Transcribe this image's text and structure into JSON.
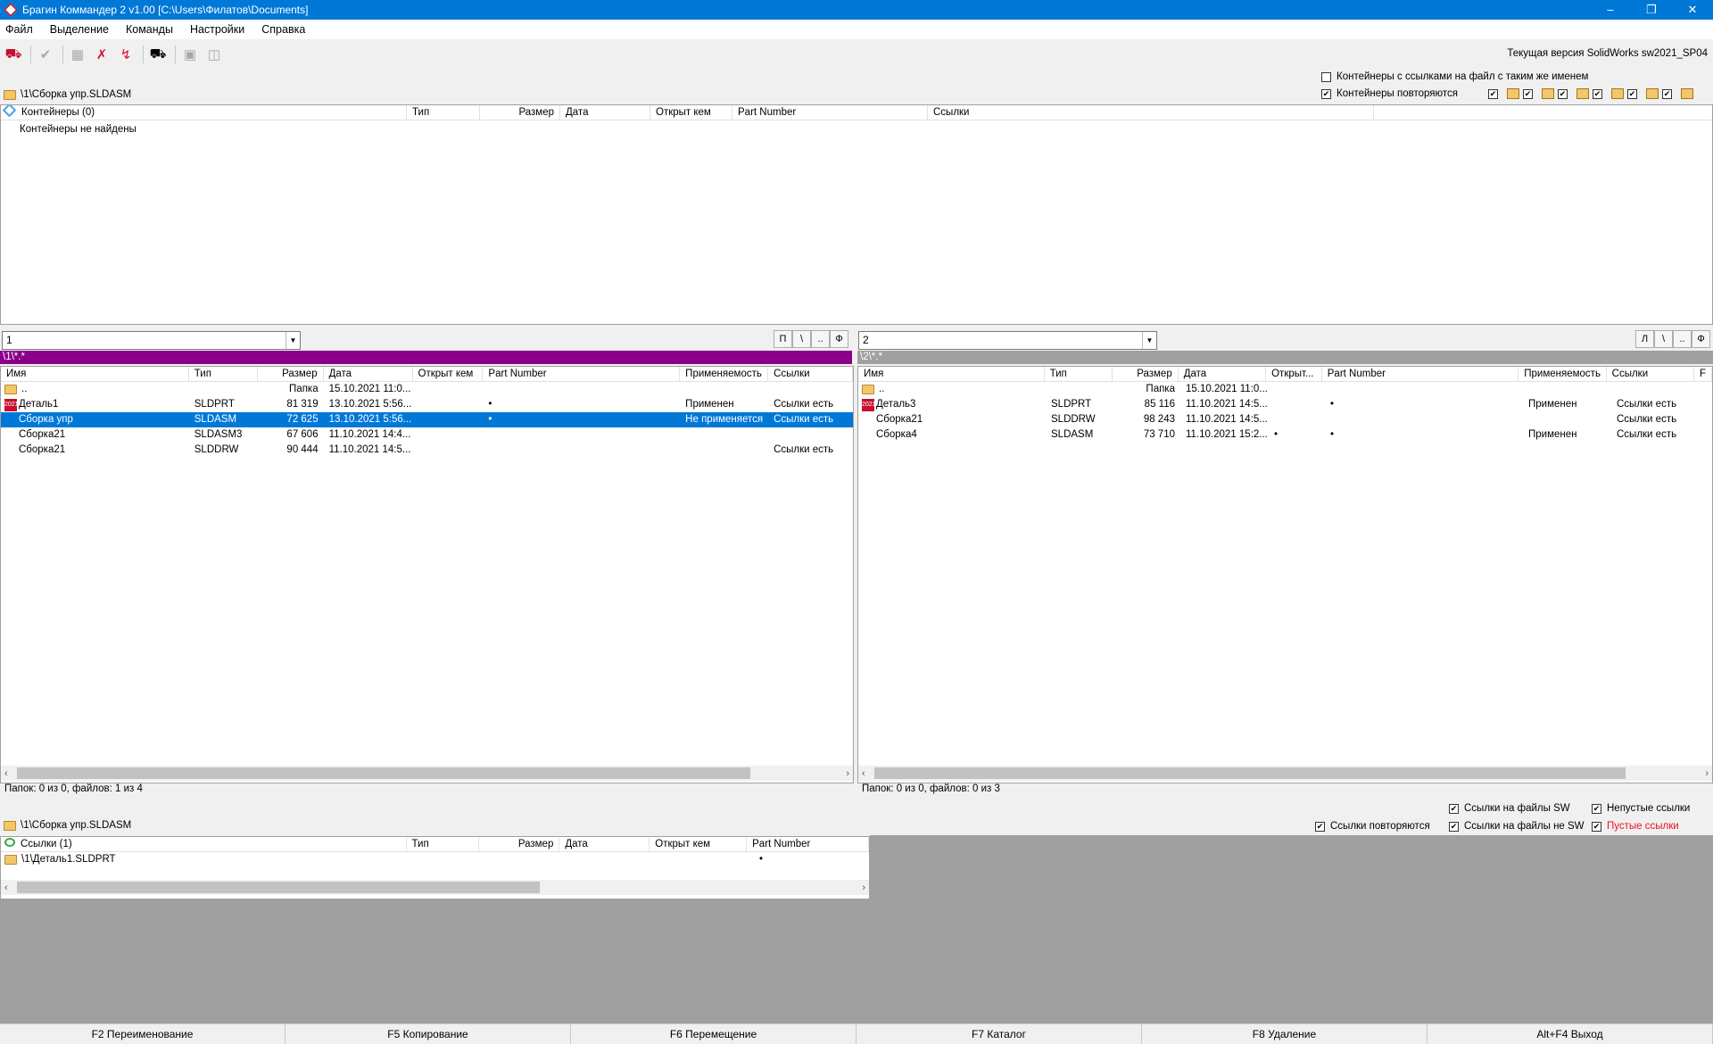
{
  "window": {
    "title": "Брагин Коммандер 2 v1.00  [C:\\Users\\Филатов\\Documents]",
    "minimize": "–",
    "restore": "❐",
    "close": "✕"
  },
  "menu": [
    "Файл",
    "Выделение",
    "Команды",
    "Настройки",
    "Справка"
  ],
  "toolbar": {
    "icons": [
      "binoculars-red-icon",
      "check-icon",
      "container-icon",
      "remove-container-icon",
      "remove-link-icon",
      "binoculars-icon",
      "window-icon",
      "window2-icon"
    ]
  },
  "version_label": "Текущая версия SolidWorks sw2021_SP04",
  "containers": {
    "opt_same_name": "Контейнеры с ссылками на файл с таким же именем",
    "opt_repeat": "Контейнеры повторяются",
    "path": "\\1\\Сборка упр.SLDASM",
    "columns": [
      "Контейнеры (0)",
      "Тип",
      "Размер",
      "Дата",
      "Открыт кем",
      "Part Number",
      "Ссылки"
    ],
    "empty_text": "Контейнеры не найдены"
  },
  "left": {
    "combo": "1",
    "nav": [
      "П",
      "\\",
      "..",
      "Ф"
    ],
    "path": "\\1\\*.*",
    "path_color": "#8b008b",
    "columns": [
      "Имя",
      "Тип",
      "Размер",
      "Дата",
      "Открыт кем",
      "Part Number",
      "Применяемость",
      "Ссылки"
    ],
    "rows": [
      {
        "icon": "folder",
        "name": "..",
        "type": "",
        "size": "Папка",
        "date": "15.10.2021 11:0...",
        "opened": "",
        "pn": "",
        "usage": "",
        "links": ""
      },
      {
        "icon": "sw",
        "name": "Деталь1",
        "type": "SLDPRT",
        "size": "81 319",
        "date": "13.10.2021 5:56...",
        "opened": "",
        "pn": "•",
        "usage": "Применен",
        "links": "Ссылки есть"
      },
      {
        "icon": "",
        "name": "Сборка упр",
        "type": "SLDASM",
        "size": "72 625",
        "date": "13.10.2021 5:56...",
        "opened": "",
        "pn": "•",
        "usage": "Не применяется",
        "links": "Ссылки есть",
        "selected": true
      },
      {
        "icon": "",
        "name": "Сборка21",
        "type": "SLDASM3",
        "size": "67 606",
        "date": "11.10.2021 14:4...",
        "opened": "",
        "pn": "",
        "usage": "",
        "links": ""
      },
      {
        "icon": "",
        "name": "Сборка21",
        "type": "SLDDRW",
        "size": "90 444",
        "date": "11.10.2021 14:5...",
        "opened": "",
        "pn": "",
        "usage": "",
        "links": "Ссылки есть"
      }
    ],
    "status": "Папок: 0 из 0, файлов: 1 из 4"
  },
  "right": {
    "combo": "2",
    "nav": [
      "Л",
      "\\",
      "..",
      "Ф"
    ],
    "path": "\\2\\*.*",
    "path_color": "#a0a0a0",
    "columns": [
      "Имя",
      "Тип",
      "Размер",
      "Дата",
      "Открыт...",
      "Part Number",
      "Применяемость",
      "Ссылки",
      "F"
    ],
    "rows": [
      {
        "icon": "folder",
        "name": "..",
        "type": "",
        "size": "Папка",
        "date": "15.10.2021 11:0...",
        "opened": "",
        "pn": "",
        "usage": "",
        "links": ""
      },
      {
        "icon": "sw",
        "name": "Деталь3",
        "type": "SLDPRT",
        "size": "85 116",
        "date": "11.10.2021 14:5...",
        "opened": "",
        "pn": "•",
        "usage": "Применен",
        "links": "Ссылки есть"
      },
      {
        "icon": "",
        "name": "Сборка21",
        "type": "SLDDRW",
        "size": "98 243",
        "date": "11.10.2021 14:5...",
        "opened": "",
        "pn": "",
        "usage": "",
        "links": "Ссылки есть"
      },
      {
        "icon": "",
        "name": "Сборка4",
        "type": "SLDASM",
        "size": "73 710",
        "date": "11.10.2021 15:2...",
        "opened": "•",
        "pn": "•",
        "usage": "Применен",
        "links": "Ссылки есть"
      }
    ],
    "status": "Папок: 0 из 0, файлов: 0 из 3"
  },
  "links": {
    "path": "\\1\\Сборка упр.SLDASM",
    "opt_repeat": "Ссылки повторяются",
    "opt_sw": "Ссылки на файлы SW",
    "opt_not_sw": "Ссылки на файлы не SW",
    "opt_nonempty": "Непустые ссылки",
    "opt_empty": "Пустые ссылки",
    "empty_color": "#e81123",
    "columns": [
      "Ссылки (1)",
      "Тип",
      "Размер",
      "Дата",
      "Открыт кем",
      "Part Number"
    ],
    "rows": [
      {
        "name": "\\1\\Деталь1.SLDPRT",
        "pn": "•"
      }
    ]
  },
  "fkeys": [
    "F2 Переименование",
    "F5 Копирование",
    "F6 Перемещение",
    "F7 Каталог",
    "F8 Удаление",
    "Alt+F4 Выход"
  ]
}
